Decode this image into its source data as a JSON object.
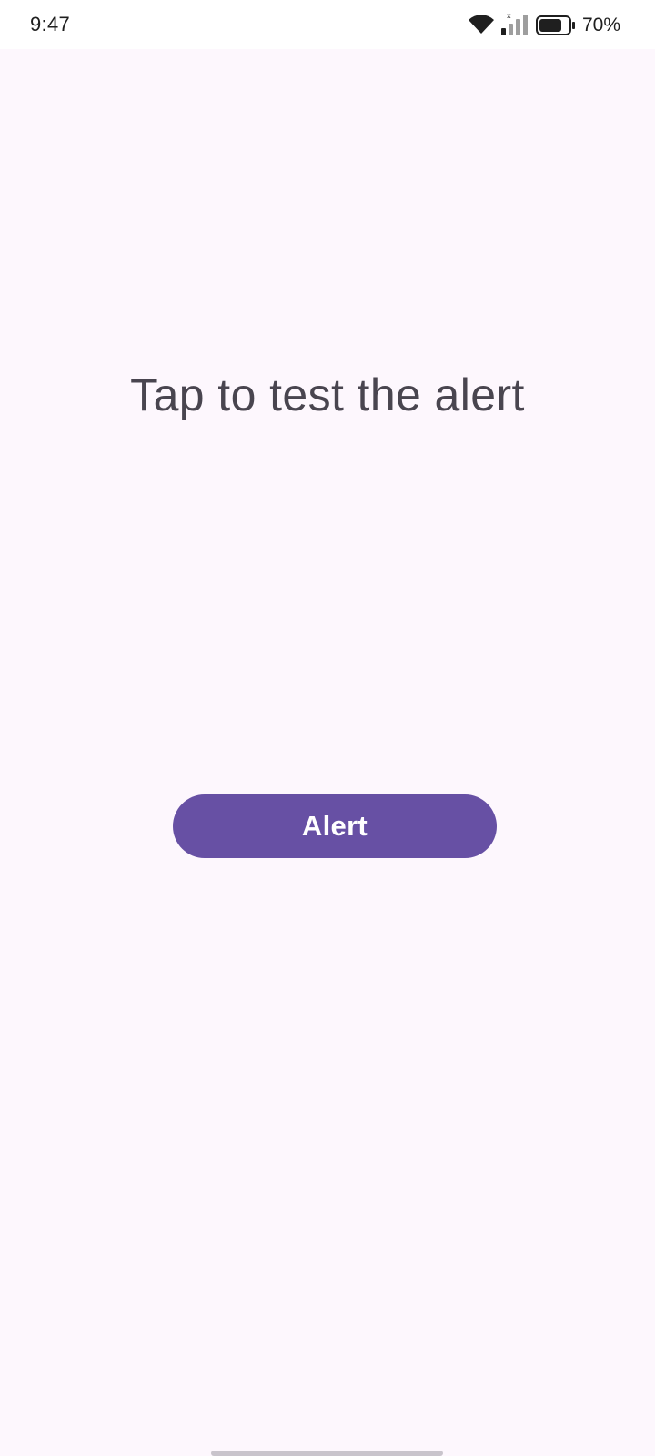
{
  "status_bar": {
    "time": "9:47",
    "battery_percent": "70%",
    "battery_level": 0.7,
    "icons": [
      "wifi-icon",
      "signal-icon",
      "battery-icon"
    ]
  },
  "main": {
    "headline": "Tap to test the alert",
    "alert_button_label": "Alert"
  },
  "colors": {
    "background": "#fdf7fd",
    "primary": "#6750a4",
    "on_primary": "#ffffff",
    "headline_text": "#49454f"
  }
}
